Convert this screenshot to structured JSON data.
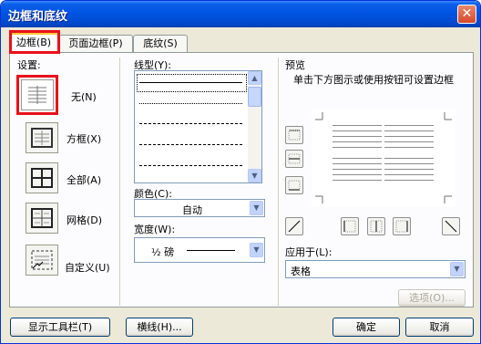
{
  "title": "边框和底纹",
  "tabs": [
    {
      "label": "边框(B)"
    },
    {
      "label": "页面边框(P)"
    },
    {
      "label": "底纹(S)"
    }
  ],
  "settings": {
    "heading": "设置:",
    "items": [
      {
        "label": "无(N)",
        "icon": "no-border-icon"
      },
      {
        "label": "方框(X)",
        "icon": "box-border-icon"
      },
      {
        "label": "全部(A)",
        "icon": "all-borders-icon"
      },
      {
        "label": "网格(D)",
        "icon": "grid-borders-icon"
      },
      {
        "label": "自定义(U)",
        "icon": "custom-border-icon"
      }
    ]
  },
  "line_style": {
    "label": "线型(Y):"
  },
  "color": {
    "label": "颜色(C):",
    "value": "自动"
  },
  "width": {
    "label": "宽度(W):",
    "value": "½ 磅"
  },
  "preview": {
    "heading": "预览",
    "hint": "单击下方图示或使用按钮可设置边框"
  },
  "apply_to": {
    "label": "应用于(L):",
    "value": "表格"
  },
  "options_button": "选项(O)...",
  "footer": {
    "toolbar_button": "显示工具栏(T)",
    "hline_button": "横线(H)...",
    "ok_button": "确定",
    "cancel_button": "取消"
  },
  "colors": {
    "title_bar": "#0054E3",
    "highlight": "#E8101A",
    "dialog": "#ECE9D8"
  }
}
